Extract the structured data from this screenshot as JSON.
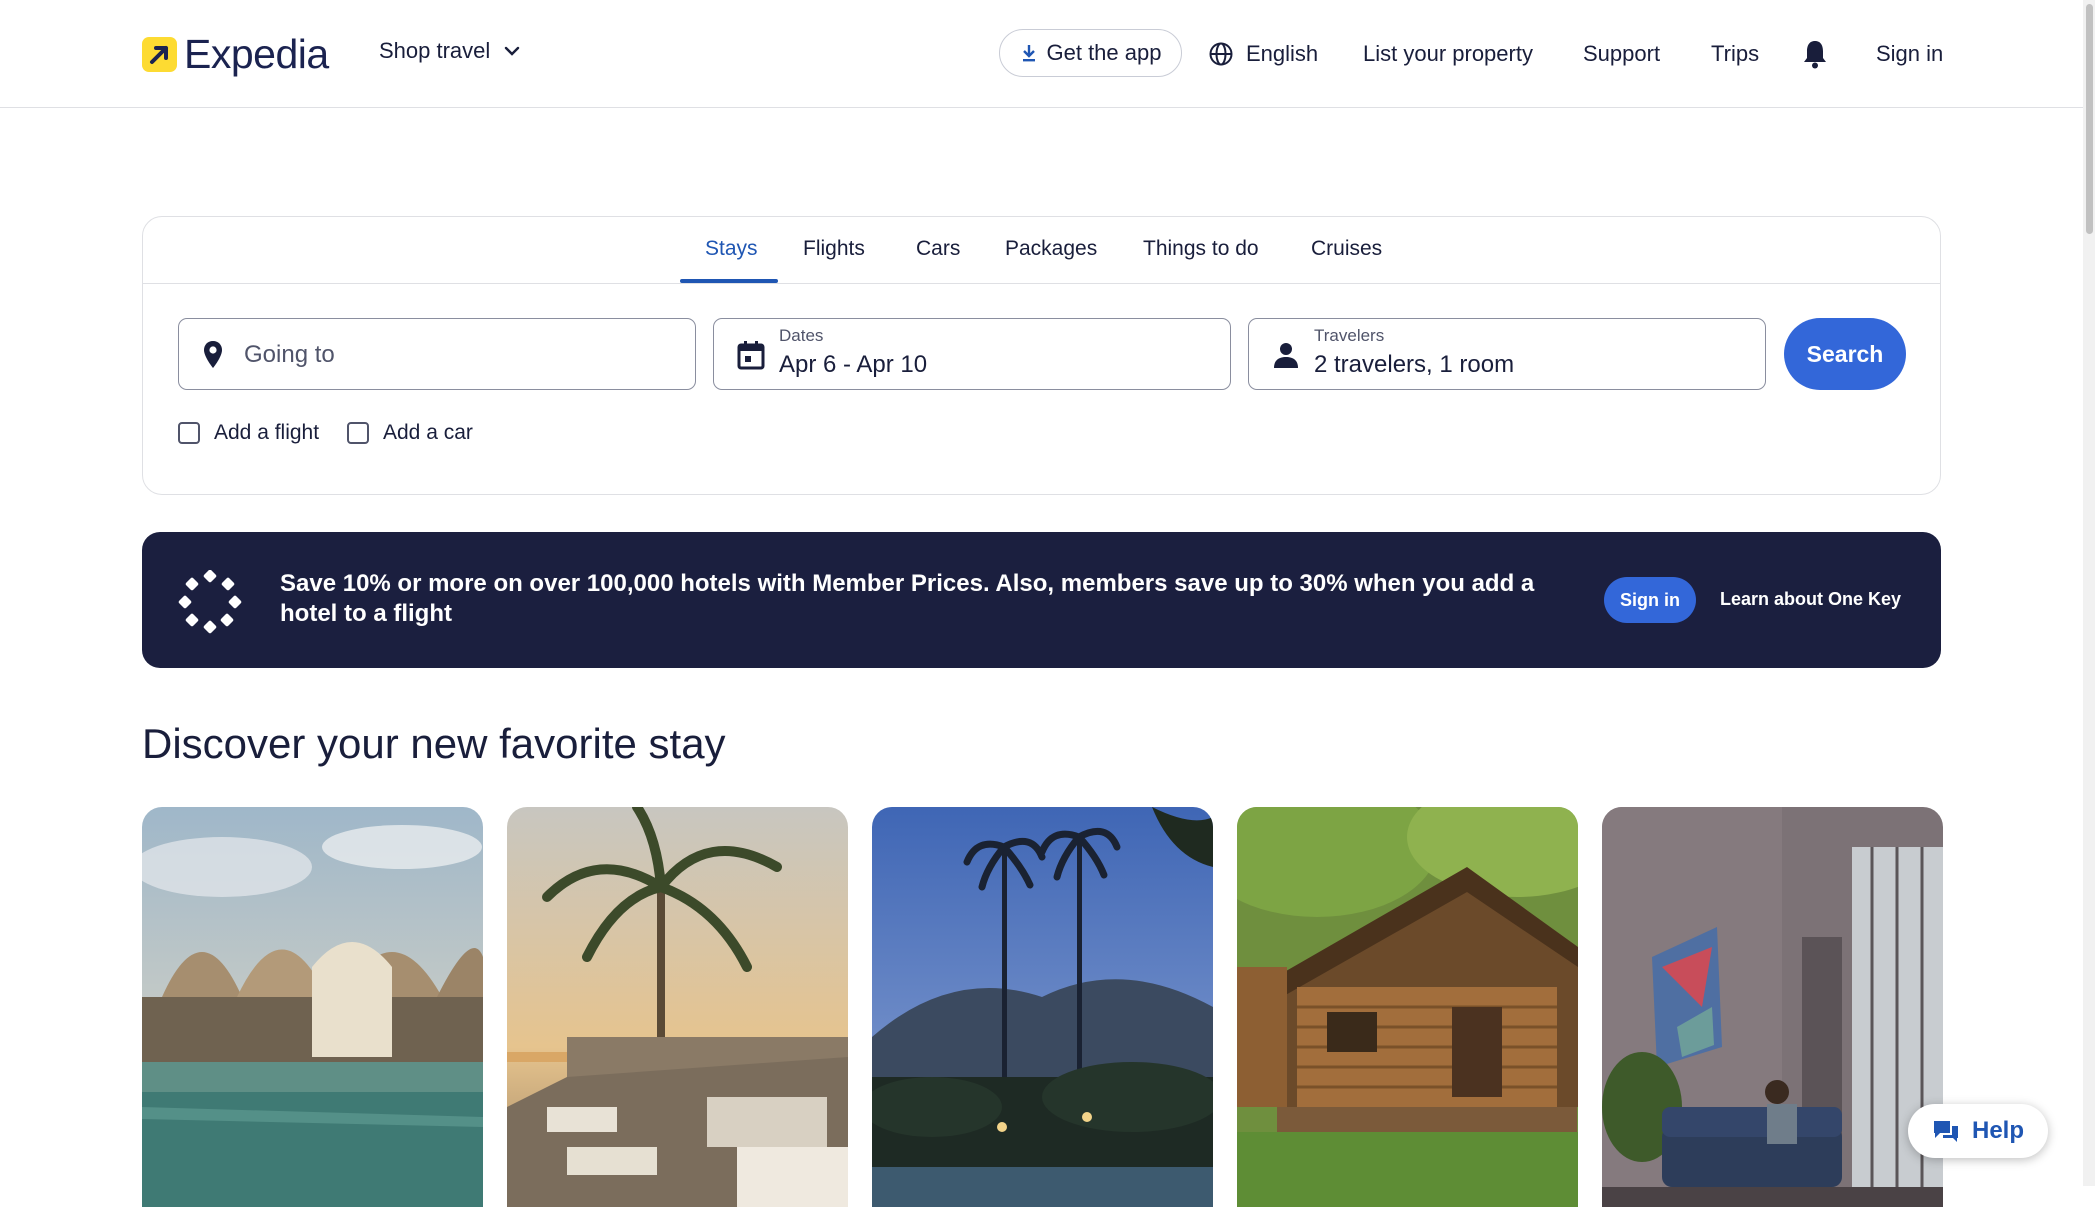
{
  "header": {
    "brand": "Expedia",
    "shop_travel": "Shop travel",
    "get_app": "Get the app",
    "language": "English",
    "list_property": "List your property",
    "support": "Support",
    "trips": "Trips",
    "sign_in": "Sign in"
  },
  "search": {
    "tabs": [
      "Stays",
      "Flights",
      "Cars",
      "Packages",
      "Things to do",
      "Cruises"
    ],
    "active_tab": "Stays",
    "going_to_placeholder": "Going to",
    "dates_label": "Dates",
    "dates_value": "Apr 6 - Apr 10",
    "travelers_label": "Travelers",
    "travelers_value": "2 travelers, 1 room",
    "search_button": "Search",
    "add_flight": "Add a flight",
    "add_car": "Add a car"
  },
  "banner": {
    "text": "Save 10% or more on over 100,000 hotels with Member Prices. Also, members save up to 30% when you add a hotel to a flight",
    "sign_in": "Sign in",
    "learn_more": "Learn about One Key"
  },
  "discover": {
    "title": "Discover your new favorite stay"
  },
  "help": {
    "label": "Help"
  },
  "colors": {
    "accent": "#3367d9",
    "brand_yellow": "#fddb32",
    "banner_bg": "#1b1f3f",
    "text": "#191e3b"
  }
}
